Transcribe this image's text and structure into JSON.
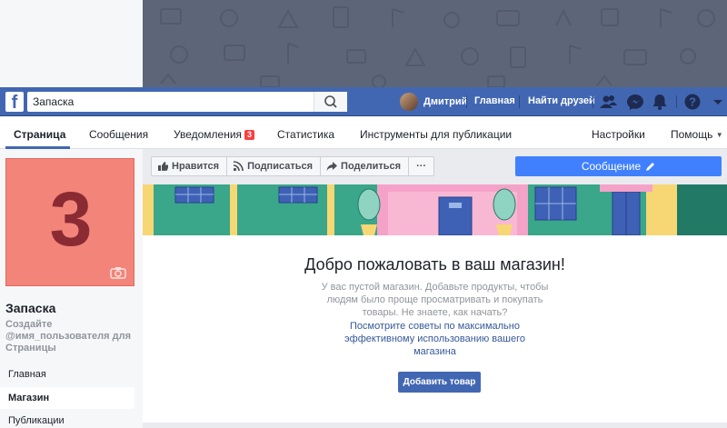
{
  "topbar": {
    "search_value": "Запаска",
    "user_name": "Дмитрий",
    "home_link": "Главная",
    "find_friends_link": "Найти друзей",
    "icons": [
      "facebook-logo-icon",
      "search-icon",
      "friend-requests-icon",
      "messenger-icon",
      "notifications-bell-icon",
      "help-icon",
      "account-menu-chevron-icon"
    ]
  },
  "tabs": {
    "page": "Страница",
    "messages": "Сообщения",
    "notifications": "Уведомления",
    "notifications_count": "3",
    "statistics": "Статистика",
    "publishing_tools": "Инструменты для публикации",
    "settings": "Настройки",
    "help": "Помощь"
  },
  "profile": {
    "picture_letter": "3",
    "page_name": "Запаска",
    "username_hint": "Создайте @имя_пользователя для Страницы"
  },
  "left_nav": [
    {
      "label": "Главная",
      "active": false
    },
    {
      "label": "Магазин",
      "active": true
    },
    {
      "label": "Публикации",
      "active": false
    }
  ],
  "actions": {
    "like": "Нравится",
    "follow": "Подписаться",
    "share": "Поделиться",
    "more": "···",
    "message": "Сообщение"
  },
  "shop": {
    "title": "Добро пожаловать в ваш магазин!",
    "description": "У вас пустой магазин. Добавьте продукты, чтобы людям было проще просматривать и покупать товары. Не знаете, как начать?",
    "tips_link": "Посмотрите советы по максимально эффективному использованию вашего магазина",
    "add_product": "Добавить товар"
  },
  "colors": {
    "brand_blue": "#4267b2",
    "message_button": "#4080ff",
    "badge_red": "#fa3e3e",
    "profile_bg": "#f28479"
  }
}
